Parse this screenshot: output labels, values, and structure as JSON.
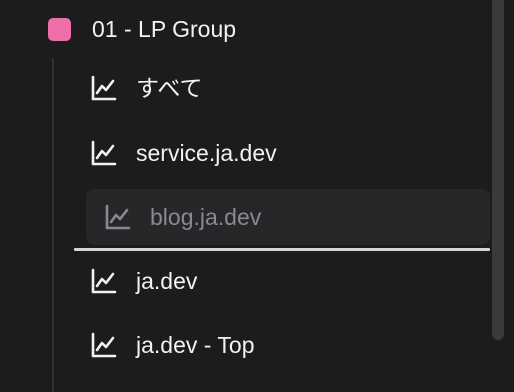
{
  "group": {
    "label": "01 - LP Group",
    "color": "#f06eaa",
    "icon": "pink-square-icon"
  },
  "items": [
    {
      "label": "すべて",
      "icon": "line-chart-icon",
      "state": "normal"
    },
    {
      "label": "service.ja.dev",
      "icon": "line-chart-icon",
      "state": "normal"
    },
    {
      "label": "blog.ja.dev",
      "icon": "line-chart-icon",
      "state": "dragging"
    },
    {
      "label": "ja.dev",
      "icon": "line-chart-icon",
      "state": "normal"
    },
    {
      "label": "ja.dev - Top",
      "icon": "line-chart-icon",
      "state": "normal"
    }
  ],
  "colors": {
    "background": "#1c1c1e",
    "text": "#f2f2f2",
    "muted_text": "#8a8a8e",
    "drag_background": "#27272a",
    "drop_indicator": "#d6d6d8",
    "scrollbar_thumb": "#3a3a3d"
  }
}
